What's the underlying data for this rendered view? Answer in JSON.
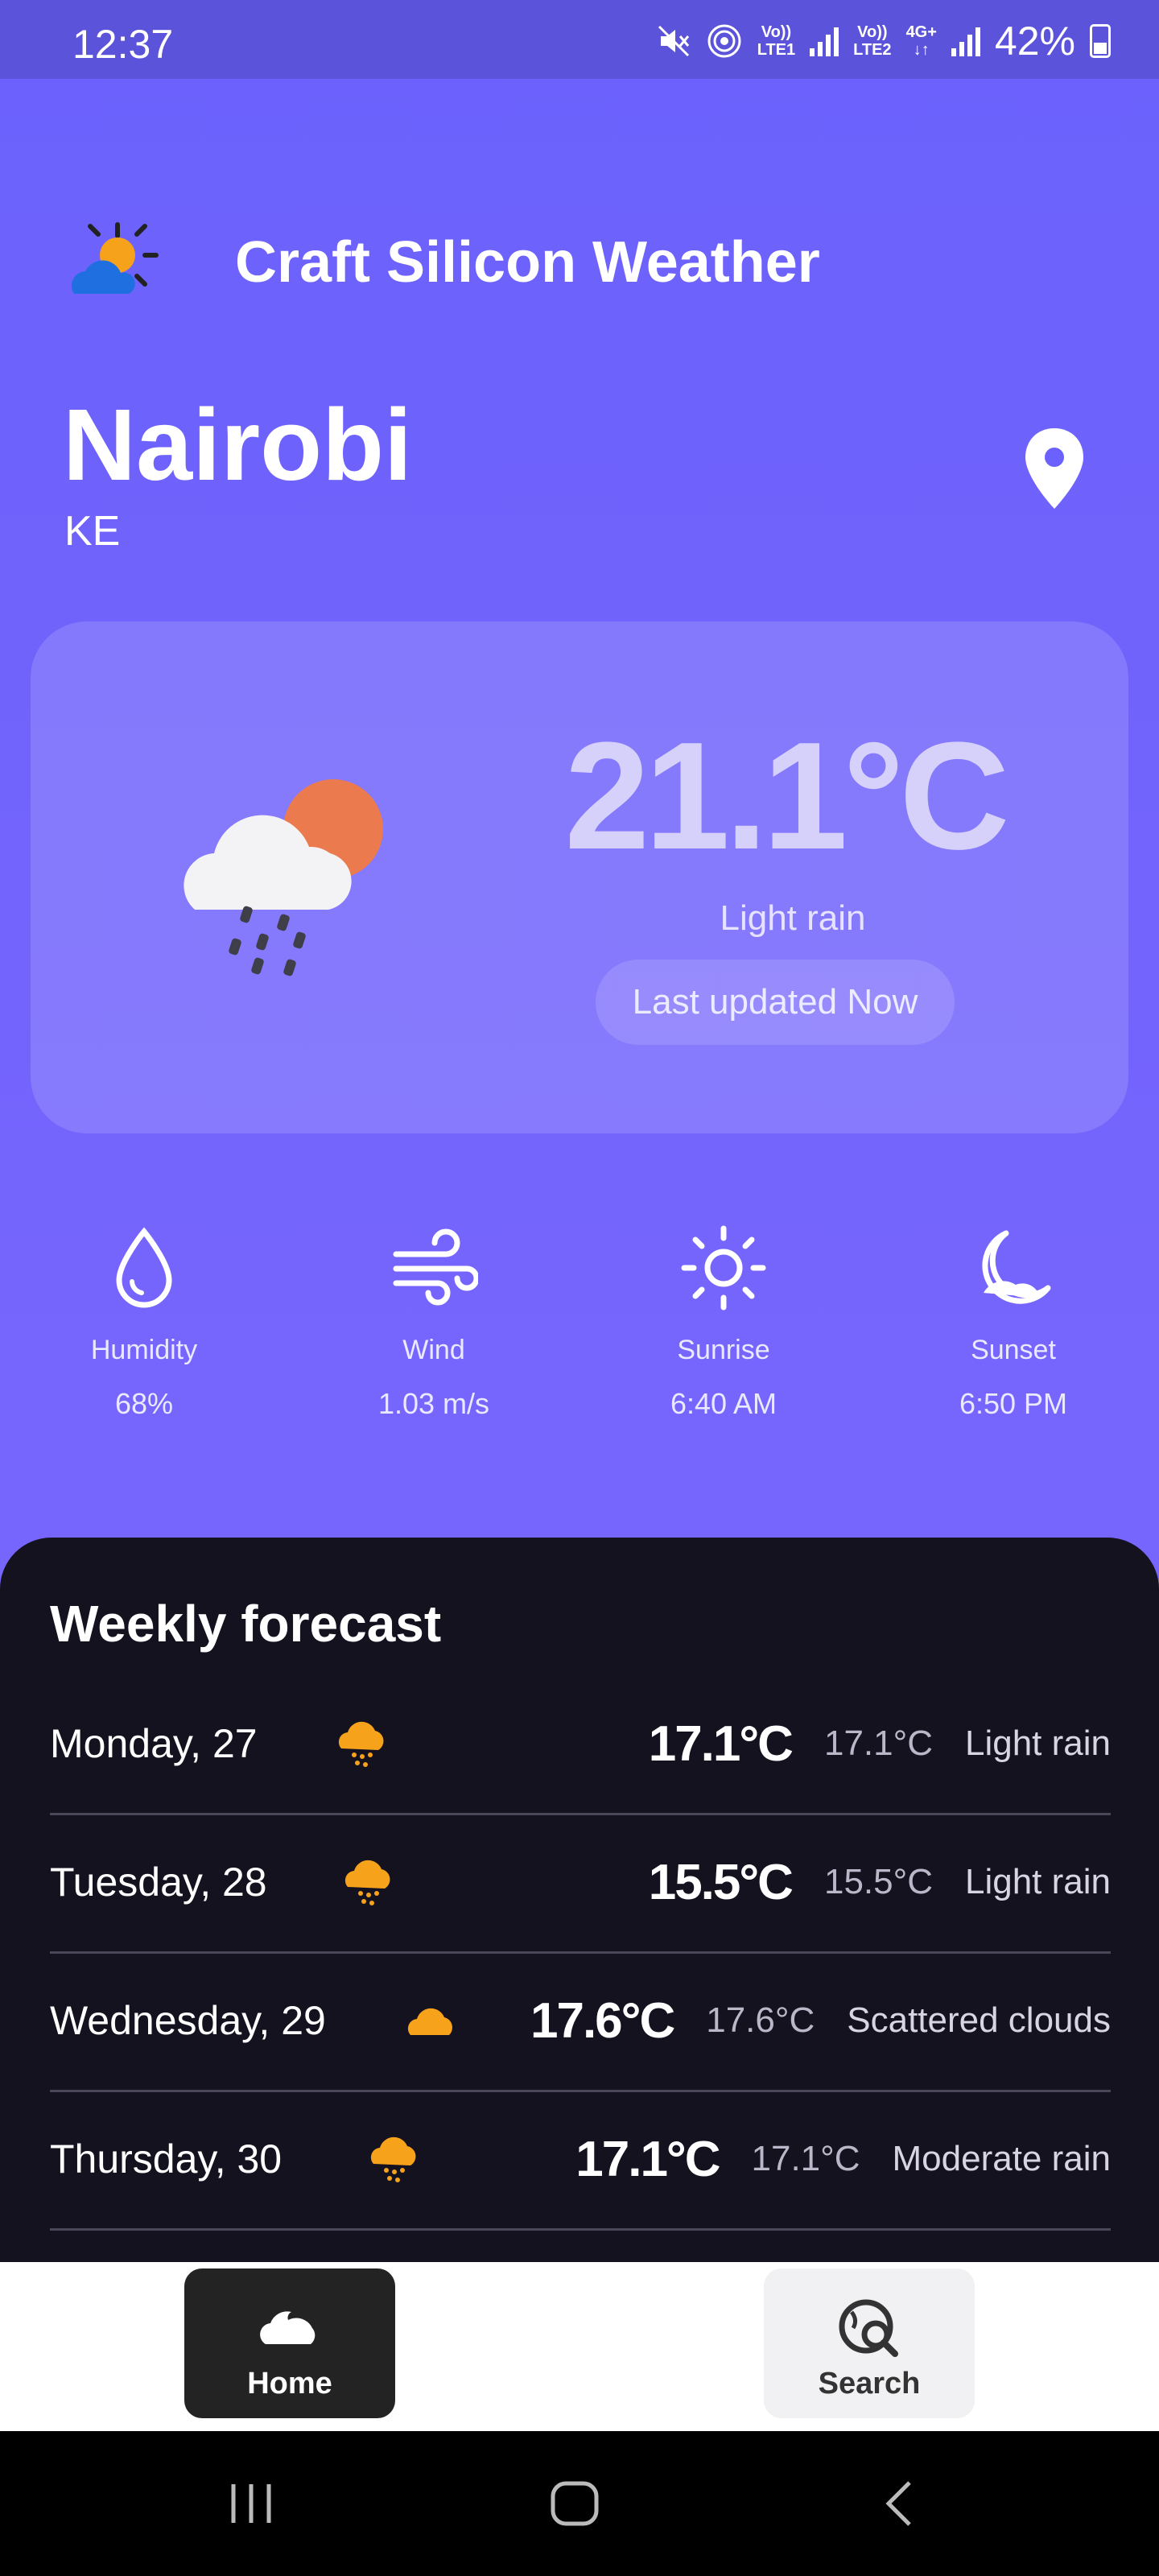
{
  "status_bar": {
    "time": "12:37",
    "net1_line1": "Vo))",
    "net1_line2": "LTE1",
    "net2_line1": "Vo))",
    "net2_line2": "LTE2",
    "net2_type": "4G+",
    "battery": "42%"
  },
  "header": {
    "app_title": "Craft Silicon Weather",
    "icon": "sun-cloud-icon"
  },
  "location": {
    "city": "Nairobi",
    "country": "KE",
    "icon": "map-pin-icon"
  },
  "current": {
    "temperature": "21.1°C",
    "description": "Light rain",
    "last_updated": "Last updated Now",
    "icon": "rain-cloud-sun-icon",
    "sun_color": "#eb7a4f"
  },
  "stats": {
    "humidity": {
      "label": "Humidity",
      "value": "68%",
      "icon": "droplet-icon"
    },
    "wind": {
      "label": "Wind",
      "value": "1.03 m/s",
      "icon": "wind-icon"
    },
    "sunrise": {
      "label": "Sunrise",
      "value": "6:40 AM",
      "icon": "sun-icon"
    },
    "sunset": {
      "label": "Sunset",
      "value": "6:50 PM",
      "icon": "moon-icon"
    }
  },
  "weekly": {
    "title": "Weekly forecast",
    "days": [
      {
        "day": "Monday, 27",
        "high": "17.1°C",
        "low": "17.1°C",
        "condition": "Light rain",
        "icon": "rain-cloud-icon"
      },
      {
        "day": "Tuesday, 28",
        "high": "15.5°C",
        "low": "15.5°C",
        "condition": "Light rain",
        "icon": "rain-cloud-icon"
      },
      {
        "day": "Wednesday, 29",
        "high": "17.6°C",
        "low": "17.6°C",
        "condition": "Scattered clouds",
        "icon": "cloud-icon"
      },
      {
        "day": "Thursday, 30",
        "high": "17.1°C",
        "low": "17.1°C",
        "condition": "Moderate rain",
        "icon": "rain-cloud-icon"
      }
    ],
    "icon_color": "#f7a21b"
  },
  "bottom_nav": {
    "home": "Home",
    "search": "Search"
  },
  "colors": {
    "background": "#6b61fc",
    "weekly_bg": "#15121f"
  }
}
